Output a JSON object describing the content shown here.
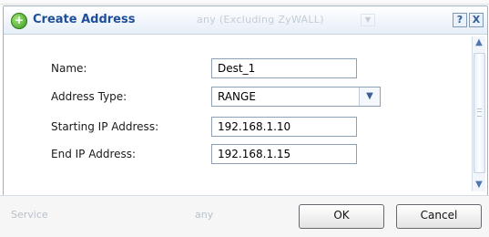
{
  "background": {
    "top_ghost_text": "any (Excluding ZyWALL)",
    "footer_left_ghost": "Service",
    "footer_mid_ghost": "any"
  },
  "dialog": {
    "title": "Create Address",
    "title_icon": "plus-circle-icon",
    "help_label": "?",
    "close_label": "X"
  },
  "form": {
    "name": {
      "label": "Name:",
      "value": "Dest_1"
    },
    "address_type": {
      "label": "Address Type:",
      "value": "RANGE"
    },
    "start_ip": {
      "label": "Starting IP Address:",
      "value": "192.168.1.10"
    },
    "end_ip": {
      "label": "End IP Address:",
      "value": "192.168.1.15"
    }
  },
  "buttons": {
    "ok": "OK",
    "cancel": "Cancel"
  },
  "colors": {
    "accent": "#1e4e9a",
    "icon_green": "#3b9a1f",
    "border": "#9db1c9"
  }
}
